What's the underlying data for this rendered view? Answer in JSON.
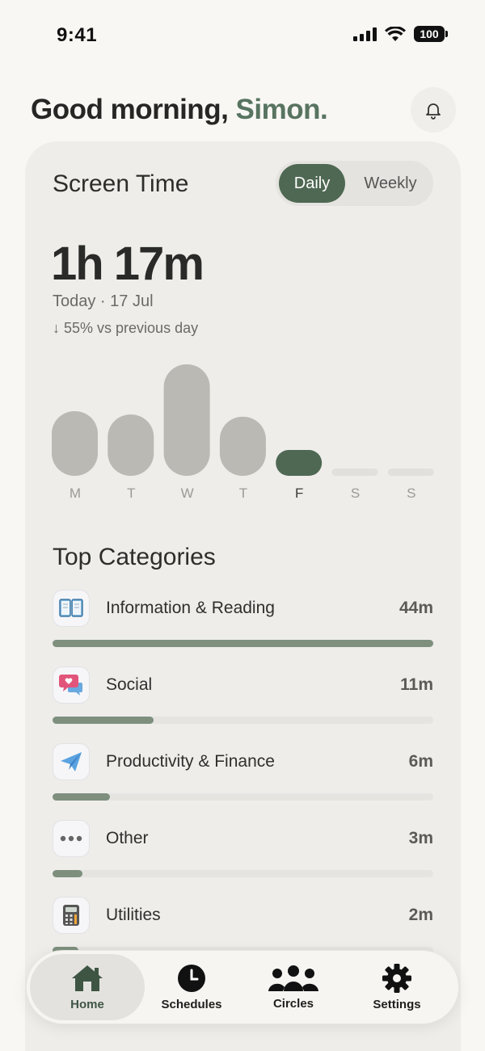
{
  "status_bar": {
    "time": "9:41",
    "battery": "100"
  },
  "greeting": {
    "prefix": "Good morning, ",
    "name": "Simon."
  },
  "screen_time": {
    "title": "Screen Time",
    "toggle": {
      "daily": "Daily",
      "weekly": "Weekly",
      "selected": "Daily"
    },
    "total": "1h 17m",
    "date": "Today · 17 Jul",
    "comparison": "↓ 55% vs previous day"
  },
  "week_chart": {
    "days": [
      {
        "label": "M",
        "level": 0.58
      },
      {
        "label": "T",
        "level": 0.55
      },
      {
        "label": "W",
        "level": 1.0
      },
      {
        "label": "T",
        "level": 0.53
      },
      {
        "label": "F",
        "level": 0.22,
        "active": true
      },
      {
        "label": "S",
        "level": 0
      },
      {
        "label": "S",
        "level": 0
      }
    ],
    "colors": {
      "bar": "#bab9b3",
      "active": "#4f6853",
      "empty": "#e1e0dc"
    }
  },
  "top_categories": {
    "title": "Top Categories",
    "items": [
      {
        "name": "Information & Reading",
        "value": "44m",
        "fraction": 1.0,
        "icon": "book-icon"
      },
      {
        "name": "Social",
        "value": "11m",
        "fraction": 0.265,
        "icon": "speech-heart-icon"
      },
      {
        "name": "Productivity & Finance",
        "value": "6m",
        "fraction": 0.15,
        "icon": "paper-plane-icon"
      },
      {
        "name": "Other",
        "value": "3m",
        "fraction": 0.078,
        "icon": "ellipsis-icon"
      },
      {
        "name": "Utilities",
        "value": "2m",
        "fraction": 0.068,
        "icon": "calculator-icon"
      }
    ]
  },
  "tab_bar": {
    "items": [
      {
        "label": "Home",
        "icon": "home-icon",
        "active": true
      },
      {
        "label": "Schedules",
        "icon": "clock-icon"
      },
      {
        "label": "Circles",
        "icon": "people-icon"
      },
      {
        "label": "Settings",
        "icon": "gear-icon"
      }
    ]
  },
  "colors": {
    "accent": "#4f6853",
    "name_green": "#587460",
    "background": "#f8f7f4",
    "card": "#eeedea"
  }
}
